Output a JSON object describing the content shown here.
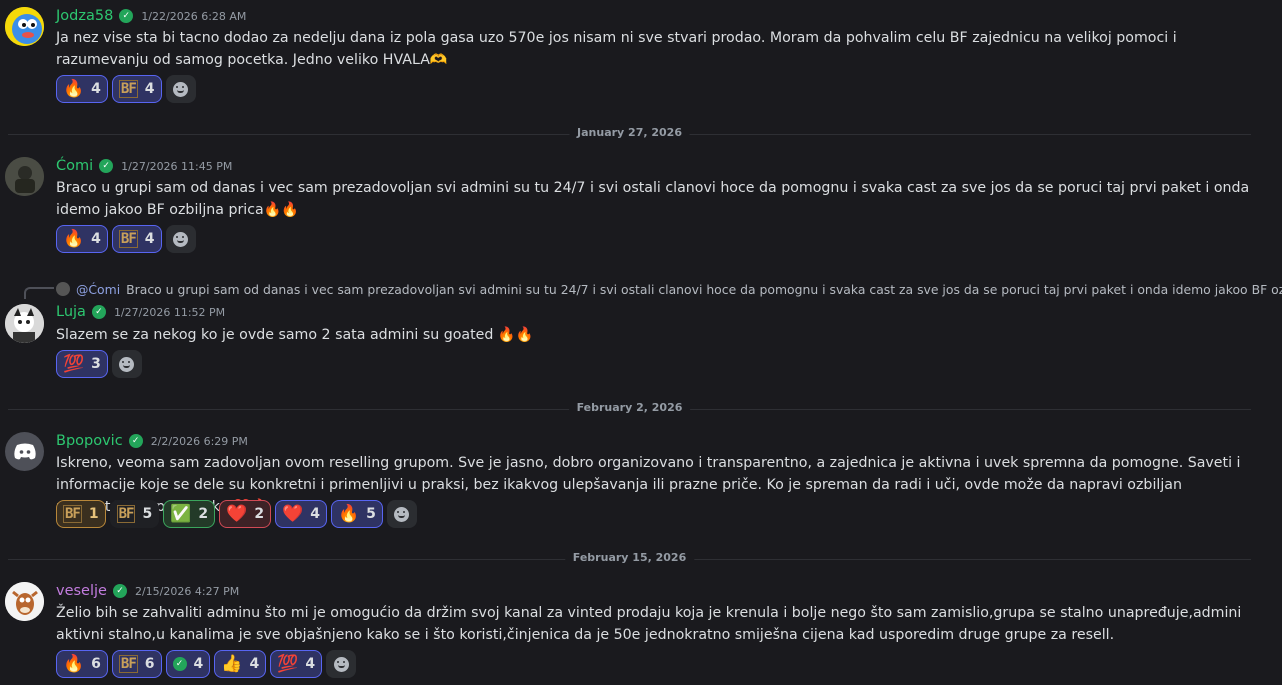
{
  "colors": {
    "green": "#2dc770",
    "purple": "#c27cde",
    "background": "#1a1a1e",
    "accent": "#5865f2"
  },
  "messages": [
    {
      "user": "Jodza58",
      "timestamp": "1/22/2026 6:28 AM",
      "text": "Ja nez vise sta bi tacno dodao za nedelju dana iz pola gasa uzo 570e jos nisam ni sve stvari prodao. Moram da pohvalim celu BF zajednicu na velikoj pomoci i razumevanju od samog pocetka. Jedno veliko HVALA🫶",
      "reactions": [
        {
          "emoji": "🔥",
          "count": "4"
        },
        {
          "emoji": "BF",
          "count": "4"
        }
      ]
    },
    {
      "user": "Ćomi",
      "timestamp": "1/27/2026 11:45 PM",
      "text": "Braco u grupi sam od danas i vec sam prezadovoljan svi admini su tu 24/7 i svi ostali clanovi hoce da pomognu i svaka cast za sve jos da se poruci taj prvi paket i onda idemo jakoo BF ozbiljna prica🔥🔥",
      "reactions": [
        {
          "emoji": "🔥",
          "count": "4"
        },
        {
          "emoji": "BF",
          "count": "4"
        }
      ]
    },
    {
      "user": "Luja",
      "timestamp": "1/27/2026 11:52 PM",
      "reply_to": "@Ćomi",
      "reply_text": "Braco u grupi sam od danas i vec sam prezadovoljan svi admini su tu 24/7 i svi ostali clanovi hoce da pomognu i svaka cast za sve jos da se poruci taj prvi paket i onda idemo jakoo BF ozbiljn...",
      "text": "Slazem se za nekog ko je ovde samo 2 sata admini su goated 🔥🔥",
      "reactions": [
        {
          "emoji": "💯",
          "count": "3"
        }
      ]
    },
    {
      "user": "Bpopovic",
      "timestamp": "2/2/2026 6:29 PM",
      "text": "Iskreno, veoma sam zadovoljan ovom reselling grupom. Sve je jasno, dobro organizovano i transparentno, a zajednica je aktivna i uvek spremna da pomogne. Saveti i informacije koje se dele su konkretni i primenljivi u praksi, bez ikakvog ulepšavanja ili prazne priče. Ko je spreman da radi i uči, ovde može da napravi ozbiljan rezultat.Topla preporuka ❤️🔥",
      "reactions": [
        {
          "emoji": "BF",
          "count": "1"
        },
        {
          "emoji": "BF",
          "count": "5"
        },
        {
          "emoji": "✅",
          "count": "2"
        },
        {
          "emoji": "❤️",
          "count": "2"
        },
        {
          "emoji": "❤️",
          "count": "4"
        },
        {
          "emoji": "🔥",
          "count": "5"
        }
      ]
    },
    {
      "user": "veselje",
      "timestamp": "2/15/2026 4:27 PM",
      "text": "Želio bih se zahvaliti adminu što mi je omogućio da držim svoj kanal za vinted prodaju koja je krenula i bolje nego što sam zamislio,grupa se stalno unapređuje,admini aktivni stalno,u kanalima je sve objašnjeno kako se i što koristi,činjenica da je 50e jednokratno smiješna cijena kad usporedim druge grupe za resell.",
      "reactions": [
        {
          "emoji": "🔥",
          "count": "6"
        },
        {
          "emoji": "BF",
          "count": "6"
        },
        {
          "emoji": "verified-badge",
          "count": "4"
        },
        {
          "emoji": "👍",
          "count": "4"
        },
        {
          "emoji": "💯",
          "count": "4"
        }
      ]
    }
  ],
  "dividers": [
    "January 27, 2026",
    "February 2, 2026",
    "February 15, 2026"
  ]
}
